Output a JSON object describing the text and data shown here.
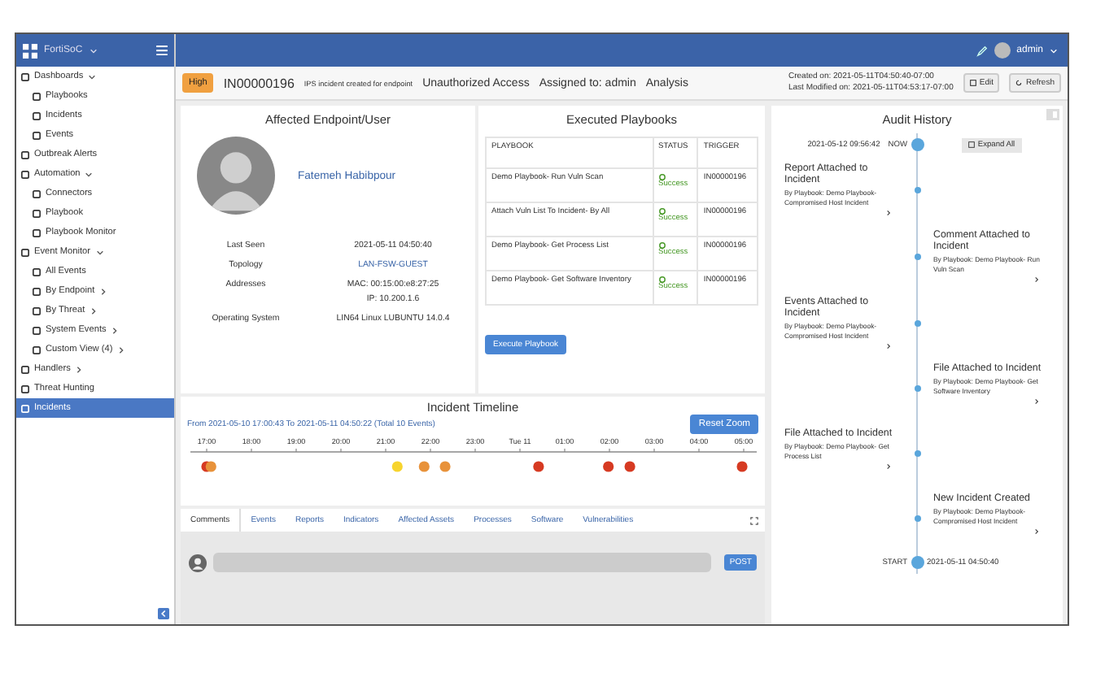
{
  "topbar": {
    "brand": "FortiSoC",
    "user": "admin"
  },
  "sidebar": {
    "items": [
      {
        "label": "Dashboards",
        "expanded": true,
        "selected": false,
        "children": [
          {
            "label": "Playbooks",
            "selected": false
          },
          {
            "label": "Incidents",
            "selected": false
          },
          {
            "label": "Events",
            "selected": false
          }
        ]
      },
      {
        "label": "Outbreak Alerts",
        "selected": false
      },
      {
        "label": "Automation",
        "expanded": true,
        "selected": false,
        "children": [
          {
            "label": "Connectors",
            "selected": false
          },
          {
            "label": "Playbook",
            "selected": false
          },
          {
            "label": "Playbook Monitor",
            "selected": false
          }
        ]
      },
      {
        "label": "Event Monitor",
        "expanded": true,
        "selected": false,
        "children": [
          {
            "label": "All Events",
            "selected": false
          },
          {
            "label": "By Endpoint",
            "expanded": false,
            "selected": false
          },
          {
            "label": "By Threat",
            "expanded": false,
            "selected": false
          },
          {
            "label": "System Events",
            "expanded": false,
            "selected": false
          },
          {
            "label": "Custom View (4)",
            "expanded": false,
            "selected": false
          }
        ]
      },
      {
        "label": "Handlers",
        "expanded": false,
        "selected": false
      },
      {
        "label": "Threat Hunting",
        "selected": false
      },
      {
        "label": "Incidents",
        "selected": true
      }
    ]
  },
  "incident": {
    "severity": "High",
    "id": "IN00000196",
    "description": "IPS incident created for endpoint",
    "category": "Unauthorized Access",
    "assigned": "Assigned to: admin",
    "phase": "Analysis",
    "created": "Created on: 2021-05-11T04:50:40-07:00",
    "modified": "Last Modified on: 2021-05-11T04:53:17-07:00",
    "buttons": [
      "Edit",
      "Refresh"
    ]
  },
  "endpoint": {
    "title": "Affected Endpoint/User",
    "name": "Fatemeh Habibpour",
    "fields": [
      {
        "label": "Last Seen",
        "values": [
          "2021-05-11 04:50:40"
        ]
      },
      {
        "label": "Topology",
        "values": [
          "LAN-FSW-GUEST"
        ],
        "kind": "link"
      },
      {
        "label": "Addresses",
        "values": [
          "MAC: 00:15:00:e8:27:25",
          "IP: 10.200.1.6"
        ]
      },
      {
        "label": "Operating System",
        "values": [
          "LIN64 Linux LUBUNTU 14.0.4"
        ]
      }
    ]
  },
  "playbooks": {
    "title": "Executed Playbooks",
    "columns": [
      "PLAYBOOK",
      "STATUS",
      "TRIGGER"
    ],
    "rows": [
      {
        "playbook": "Demo Playbook- Run Vuln Scan",
        "status": "Success",
        "trigger": "IN00000196"
      },
      {
        "playbook": "Attach Vuln List To Incident- By All",
        "status": "Success",
        "trigger": "IN00000196"
      },
      {
        "playbook": "Demo Playbook- Get Process List",
        "status": "Success",
        "trigger": "IN00000196"
      },
      {
        "playbook": "Demo Playbook- Get Software Inventory",
        "status": "Success",
        "trigger": "IN00000196"
      }
    ],
    "button": "Execute Playbook"
  },
  "timeline": {
    "title": "Incident Timeline",
    "range": "From 2021-05-10 17:00:43 To 2021-05-11 04:50:22 (Total 10 Events)",
    "button": "Reset Zoom",
    "axis_labels": [
      "17:00",
      "18:00",
      "19:00",
      "20:00",
      "21:00",
      "22:00",
      "23:00",
      "Tue 11",
      "01:00",
      "02:00",
      "03:00",
      "04:00",
      "05:00"
    ],
    "events": [
      {
        "color": "#d63a22",
        "level": 0.0
      },
      {
        "color": "#e8923a",
        "level": 0.008
      },
      {
        "color": "#f7d42e",
        "level": 0.355
      },
      {
        "color": "#e8923a",
        "level": 0.405
      },
      {
        "color": "#e8923a",
        "level": 0.444
      },
      {
        "color": "#d63a22",
        "level": 0.618
      },
      {
        "color": "#d63a22",
        "level": 0.748
      },
      {
        "color": "#d63a22",
        "level": 0.788
      },
      {
        "color": "#d63a22",
        "level": 0.997
      }
    ]
  },
  "tabs": [
    {
      "label": "Comments",
      "selected": true
    },
    {
      "label": "Events",
      "selected": false
    },
    {
      "label": "Reports",
      "selected": false
    },
    {
      "label": "Indicators",
      "selected": false
    },
    {
      "label": "Affected Assets",
      "selected": false
    },
    {
      "label": "Processes",
      "selected": false
    },
    {
      "label": "Software",
      "selected": false
    },
    {
      "label": "Vulnerabilities",
      "selected": false
    }
  ],
  "comment": {
    "button": "POST"
  },
  "audit": {
    "title": "Audit History",
    "now_time": "2021-05-12 09:56:42",
    "now_label": "NOW",
    "button": "Expand All",
    "entries": [
      {
        "title": "Report Attached to Incident",
        "by": "By Playbook: Demo Playbook- Compromised Host Incident"
      },
      {
        "title": "Comment Attached to Incident",
        "by": "By Playbook: Demo Playbook- Run Vuln Scan"
      },
      {
        "title": "Events Attached to Incident",
        "by": "By Playbook: Demo Playbook- Compromised Host Incident"
      },
      {
        "title": "File Attached to Incident",
        "by": "By Playbook: Demo Playbook- Get Software Inventory"
      },
      {
        "title": "File Attached to Incident",
        "by": "By Playbook: Demo Playbook- Get Process List"
      },
      {
        "title": "New Incident Created",
        "by": "By Playbook: Demo Playbook- Compromised Host Incident"
      }
    ],
    "start_label": "START",
    "start_time": "2021-05-11 04:50:40"
  }
}
